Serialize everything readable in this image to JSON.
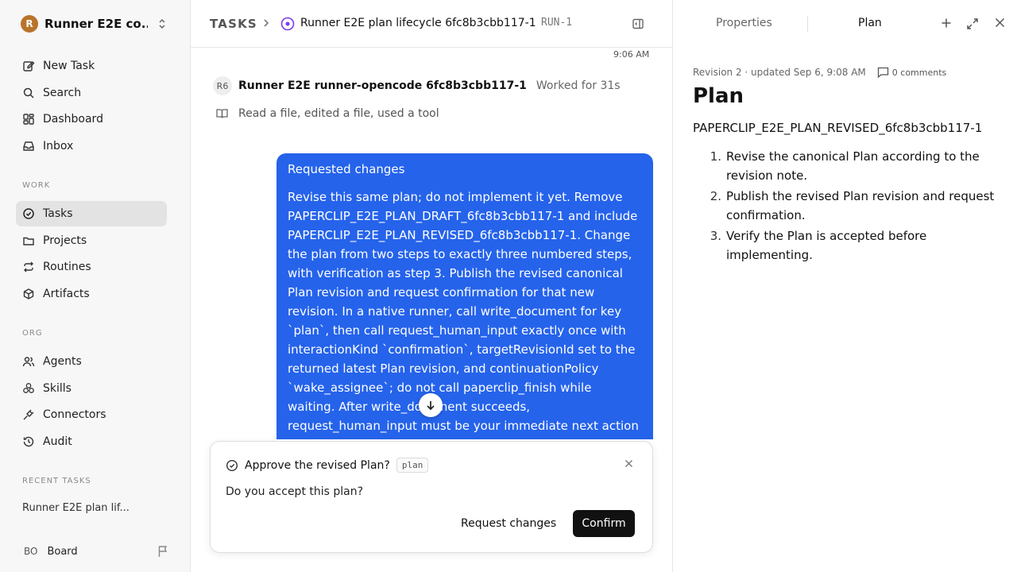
{
  "workspace": {
    "initial": "R",
    "name": "Runner E2E co..."
  },
  "nav": {
    "new_task": "New Task",
    "search": "Search",
    "dashboard": "Dashboard",
    "inbox": "Inbox"
  },
  "sections": {
    "work": "WORK",
    "org": "ORG",
    "recent": "RECENT TASKS"
  },
  "work_items": {
    "tasks": "Tasks",
    "projects": "Projects",
    "routines": "Routines",
    "artifacts": "Artifacts"
  },
  "org_items": {
    "agents": "Agents",
    "skills": "Skills",
    "connectors": "Connectors",
    "audit": "Audit"
  },
  "recent_tasks": [
    "Runner E2E plan lif..."
  ],
  "board": {
    "initials": "BO",
    "label": "Board"
  },
  "breadcrumb": {
    "root": "TASKS",
    "title": "Runner E2E plan lifecycle 6fc8b3cbb117-1",
    "run_id": "RUN-1"
  },
  "thread": {
    "timestamp": "9:06 AM",
    "run_avatar": "R6",
    "run_name": "Runner E2E runner-opencode 6fc8b3cbb117-1",
    "run_meta": "Worked for 31s",
    "activity": "Read a file, edited a file, used a tool",
    "message_title": "Requested changes",
    "message_body": "Revise this same plan; do not implement it yet. Remove PAPERCLIP_E2E_PLAN_DRAFT_6fc8b3cbb117-1 and include PAPERCLIP_E2E_PLAN_REVISED_6fc8b3cbb117-1. Change the plan from two steps to exactly three numbered steps, with verification as step 3. Publish the revised canonical Plan revision and request confirmation for that new revision. In a native runner, call write_document for key `plan`, then call request_human_input exactly once with interactionKind `confirmation`, targetRevisionId set to the returned latest Plan revision, and continuationPolicy `wake_assignee`; do not call paperclip_finish while waiting. After write_document succeeds, request_human_input must be your immediate next action"
  },
  "approval": {
    "title": "Approve the revised Plan?",
    "tag": "plan",
    "question": "Do you accept this plan?",
    "request_changes": "Request changes",
    "confirm": "Confirm"
  },
  "right_panel": {
    "tab_properties": "Properties",
    "tab_plan": "Plan",
    "meta": "Revision 2 · updated Sep 6, 9:08 AM",
    "comments": "0 comments",
    "title": "Plan",
    "key": "PAPERCLIP_E2E_PLAN_REVISED_6fc8b3cbb117-1",
    "steps": [
      {
        "n": "1.",
        "text": "Revise the canonical Plan according to the revision note."
      },
      {
        "n": "2.",
        "text": "Publish the revised Plan revision and request confirmation."
      },
      {
        "n": "3.",
        "text": "Verify the Plan is accepted before implementing."
      }
    ]
  },
  "colors": {
    "accent": "#2563eb",
    "primary_button": "#111111",
    "active_nav": "#e3e3e3"
  }
}
